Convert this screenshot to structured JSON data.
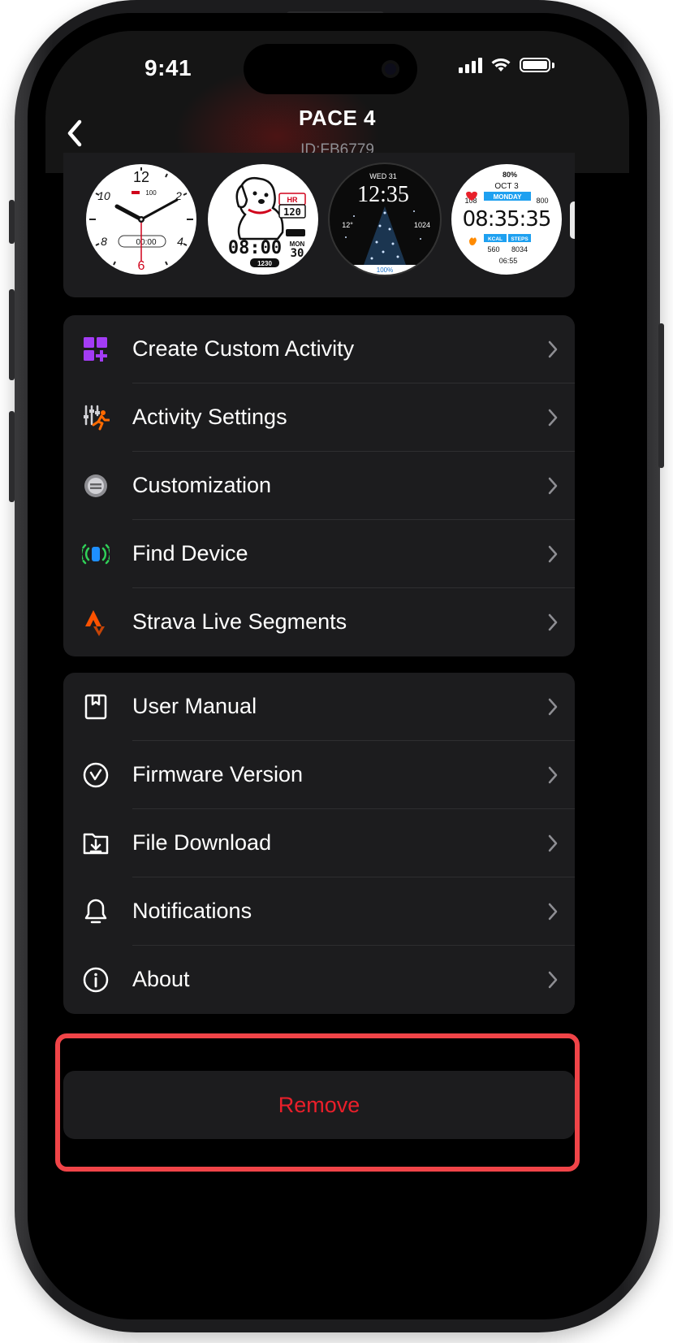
{
  "status": {
    "time": "9:41"
  },
  "nav": {
    "title": "PACE 4",
    "device_id": "ID:FB6779"
  },
  "watch_faces": [
    {
      "name": "analog-classic",
      "hour_12": "12",
      "hour_10": "10",
      "hour_2": "2",
      "hour_8": "8",
      "hour_4": "4",
      "hour_6": "6",
      "steps": "100",
      "timer": "00:00"
    },
    {
      "name": "dog",
      "hr_label": "HR",
      "hr_value": "120",
      "time": "08:00",
      "month": "MON",
      "day": "30",
      "calories": "1230"
    },
    {
      "name": "christmas-tree",
      "date": "WED 31",
      "time": "12:35",
      "temp": "12°",
      "pressure": "1024",
      "battery": "100%"
    },
    {
      "name": "digital-sport",
      "battery": "80%",
      "date": "OCT 3",
      "hr": "108",
      "day": "MONDAY",
      "elevation": "800",
      "time": "08:35:35",
      "kcal_label": "KCAL",
      "steps_label": "STEPS",
      "kcal": "560",
      "steps": "8034",
      "sunrise": "06:55"
    }
  ],
  "menu_group_1": [
    {
      "label": "Create Custom Activity",
      "icon": "grid-plus-icon"
    },
    {
      "label": "Activity Settings",
      "icon": "running-settings-icon"
    },
    {
      "label": "Customization",
      "icon": "watch-icon"
    },
    {
      "label": "Find Device",
      "icon": "find-device-icon"
    },
    {
      "label": "Strava Live Segments",
      "icon": "strava-icon"
    }
  ],
  "menu_group_2": [
    {
      "label": "User Manual",
      "icon": "book-icon"
    },
    {
      "label": "Firmware Version",
      "icon": "check-circle-icon"
    },
    {
      "label": "File Download",
      "icon": "folder-download-icon"
    },
    {
      "label": "Notifications",
      "icon": "bell-icon"
    },
    {
      "label": "About",
      "icon": "info-icon"
    }
  ],
  "remove_label": "Remove",
  "colors": {
    "accent_red": "#ea1f2a",
    "outline_red": "#f04448",
    "card": "#1c1c1e",
    "purple": "#a33cf5",
    "orange": "#fc5200",
    "green": "#30d158"
  }
}
